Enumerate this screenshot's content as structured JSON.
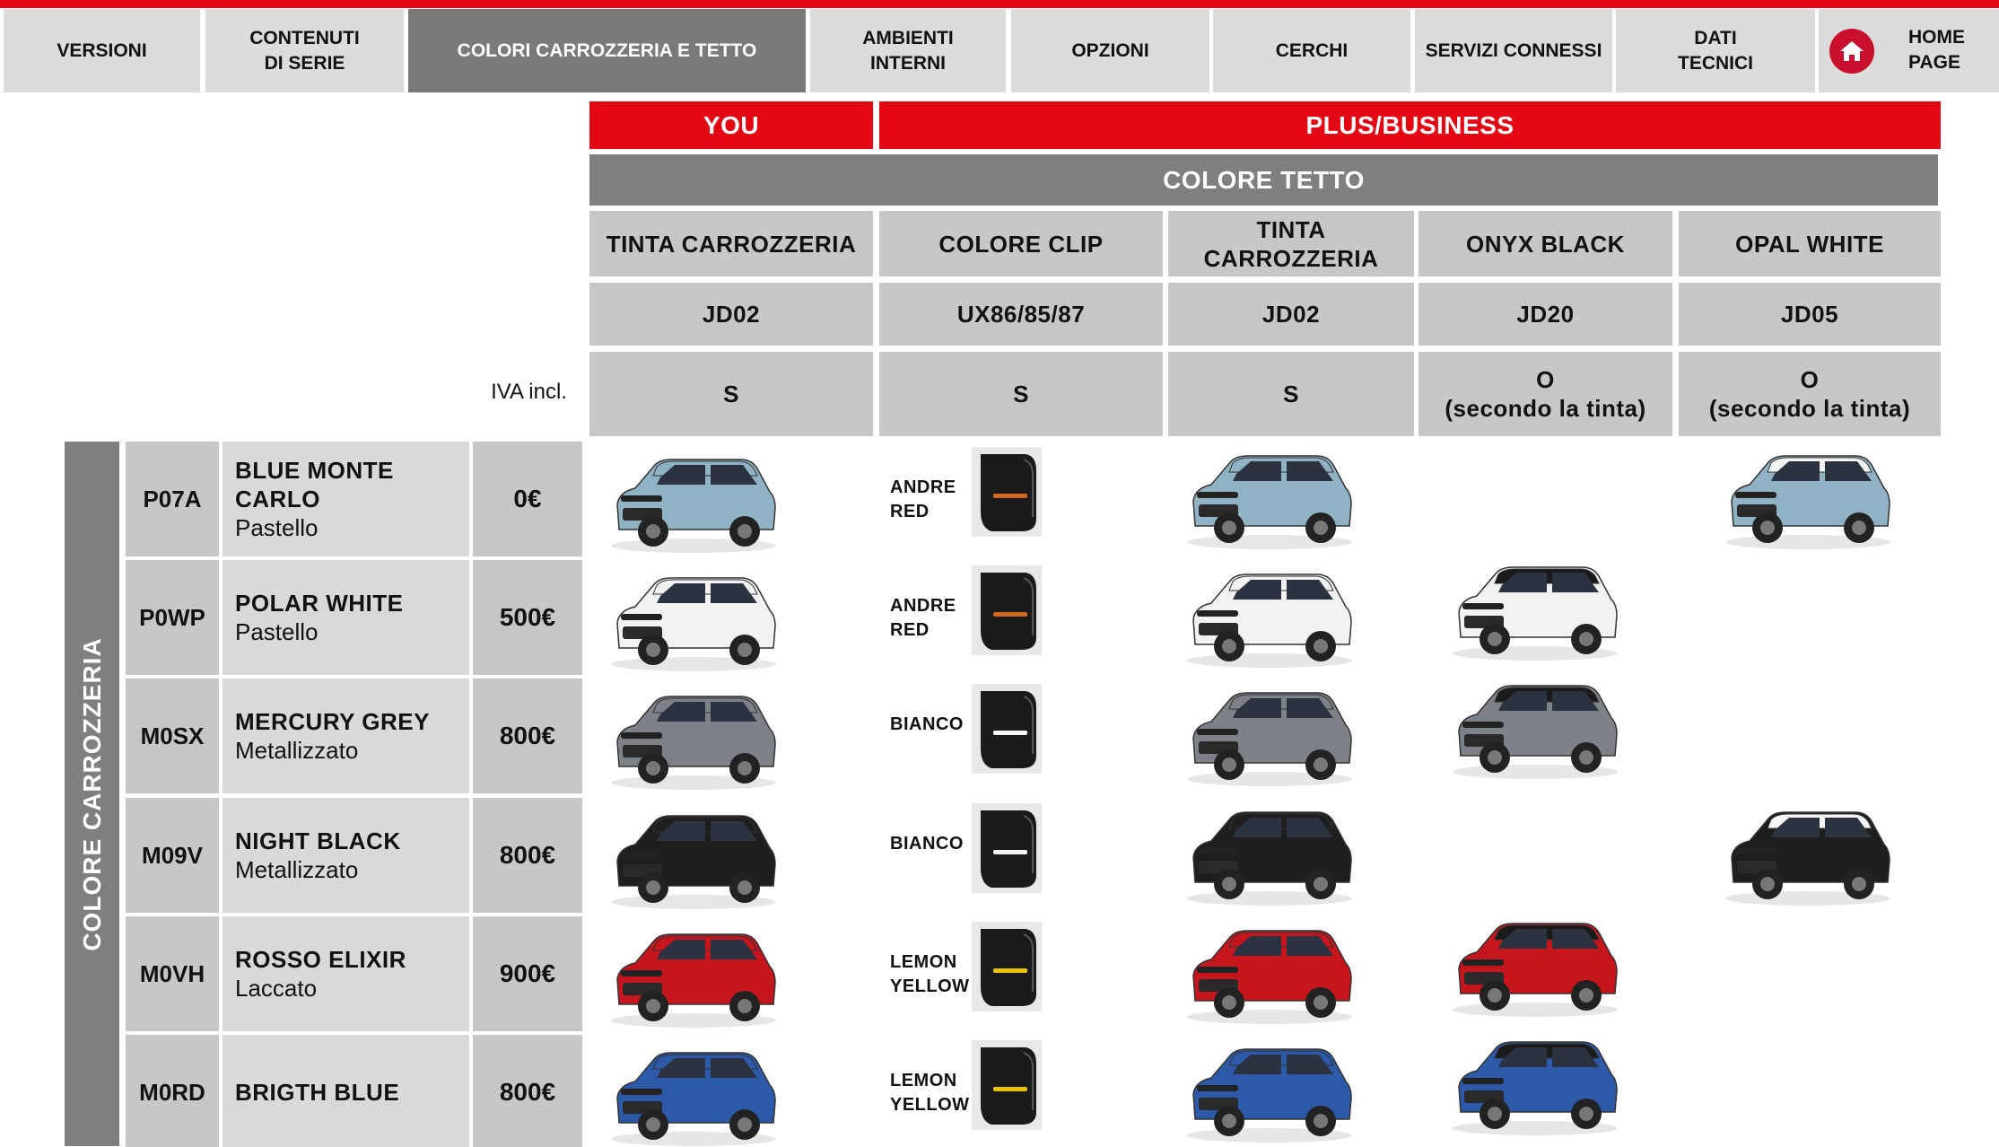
{
  "nav": [
    {
      "label": "VERSIONI",
      "active": false
    },
    {
      "label": "CONTENUTI\nDI SERIE",
      "active": false
    },
    {
      "label": "COLORI CARROZZERIA E TETTO",
      "active": true
    },
    {
      "label": "AMBIENTI\nINTERNI",
      "active": false
    },
    {
      "label": "OPZIONI",
      "active": false
    },
    {
      "label": "CERCHI",
      "active": false
    },
    {
      "label": "SERVIZI CONNESSI",
      "active": false
    },
    {
      "label": "DATI\nTECNICI",
      "active": false
    },
    {
      "label": "HOME\nPAGE",
      "active": false
    }
  ],
  "header": {
    "you": "YOU",
    "plus_business": "PLUS/BUSINESS",
    "colore_tetto": "COLORE TETTO",
    "iva": "IVA incl.",
    "columns": [
      {
        "title": "TINTA CARROZZERIA",
        "code": "JD02",
        "avail": "S"
      },
      {
        "title": "COLORE CLIP",
        "code": "UX86/85/87",
        "avail": "S"
      },
      {
        "title": "TINTA\nCARROZZERIA",
        "code": "JD02",
        "avail": "S"
      },
      {
        "title": "ONYX BLACK",
        "code": "JD20",
        "avail": "O\n(secondo la tinta)"
      },
      {
        "title": "OPAL WHITE",
        "code": "JD05",
        "avail": "O\n(secondo la tinta)"
      }
    ]
  },
  "sidebar_label": "COLORE CARROZZERIA",
  "colors": {
    "brand_red": "#e30613",
    "header_gray": "#7f7f7f",
    "cell_gray": "#c7c7c7",
    "name_gray": "#d9d9d9"
  },
  "rows": [
    {
      "code": "P07A",
      "name": "BLUE MONTE\nCARLO",
      "finish": "Pastello",
      "price": "0€",
      "clip": "ANDRE\nRED",
      "clip_stripe": "#d2691e",
      "body": "#8fb3c4",
      "roof": "#8fb3c4",
      "onyx": false,
      "opal": true
    },
    {
      "code": "P0WP",
      "name": "POLAR WHITE",
      "finish": "Pastello",
      "price": "500€",
      "clip": "ANDRE\nRED",
      "clip_stripe": "#d2691e",
      "body": "#f2f2f2",
      "roof": "#f2f2f2",
      "onyx": true,
      "opal": false
    },
    {
      "code": "M0SX",
      "name": "MERCURY GREY",
      "finish": "Metallizzato",
      "price": "800€",
      "clip": "BIANCO",
      "clip_stripe": "#f5f5f5",
      "body": "#7d8289",
      "roof": "#7d8289",
      "onyx": true,
      "opal": false
    },
    {
      "code": "M09V",
      "name": "NIGHT BLACK",
      "finish": "Metallizzato",
      "price": "800€",
      "clip": "BIANCO",
      "clip_stripe": "#f5f5f5",
      "body": "#1e1e1e",
      "roof": "#1e1e1e",
      "onyx": false,
      "opal": true
    },
    {
      "code": "M0VH",
      "name": "ROSSO ELIXIR",
      "finish": "Laccato",
      "price": "900€",
      "clip": "LEMON\nYELLOW",
      "clip_stripe": "#e8c400",
      "body": "#c4161c",
      "roof": "#c4161c",
      "onyx": true,
      "opal": false
    },
    {
      "code": "M0RD",
      "name": "BRIGTH BLUE",
      "finish": "",
      "price": "800€",
      "clip": "LEMON\nYELLOW",
      "clip_stripe": "#e8c400",
      "body": "#2c5aa8",
      "roof": "#2c5aa8",
      "onyx": true,
      "opal": false
    }
  ]
}
